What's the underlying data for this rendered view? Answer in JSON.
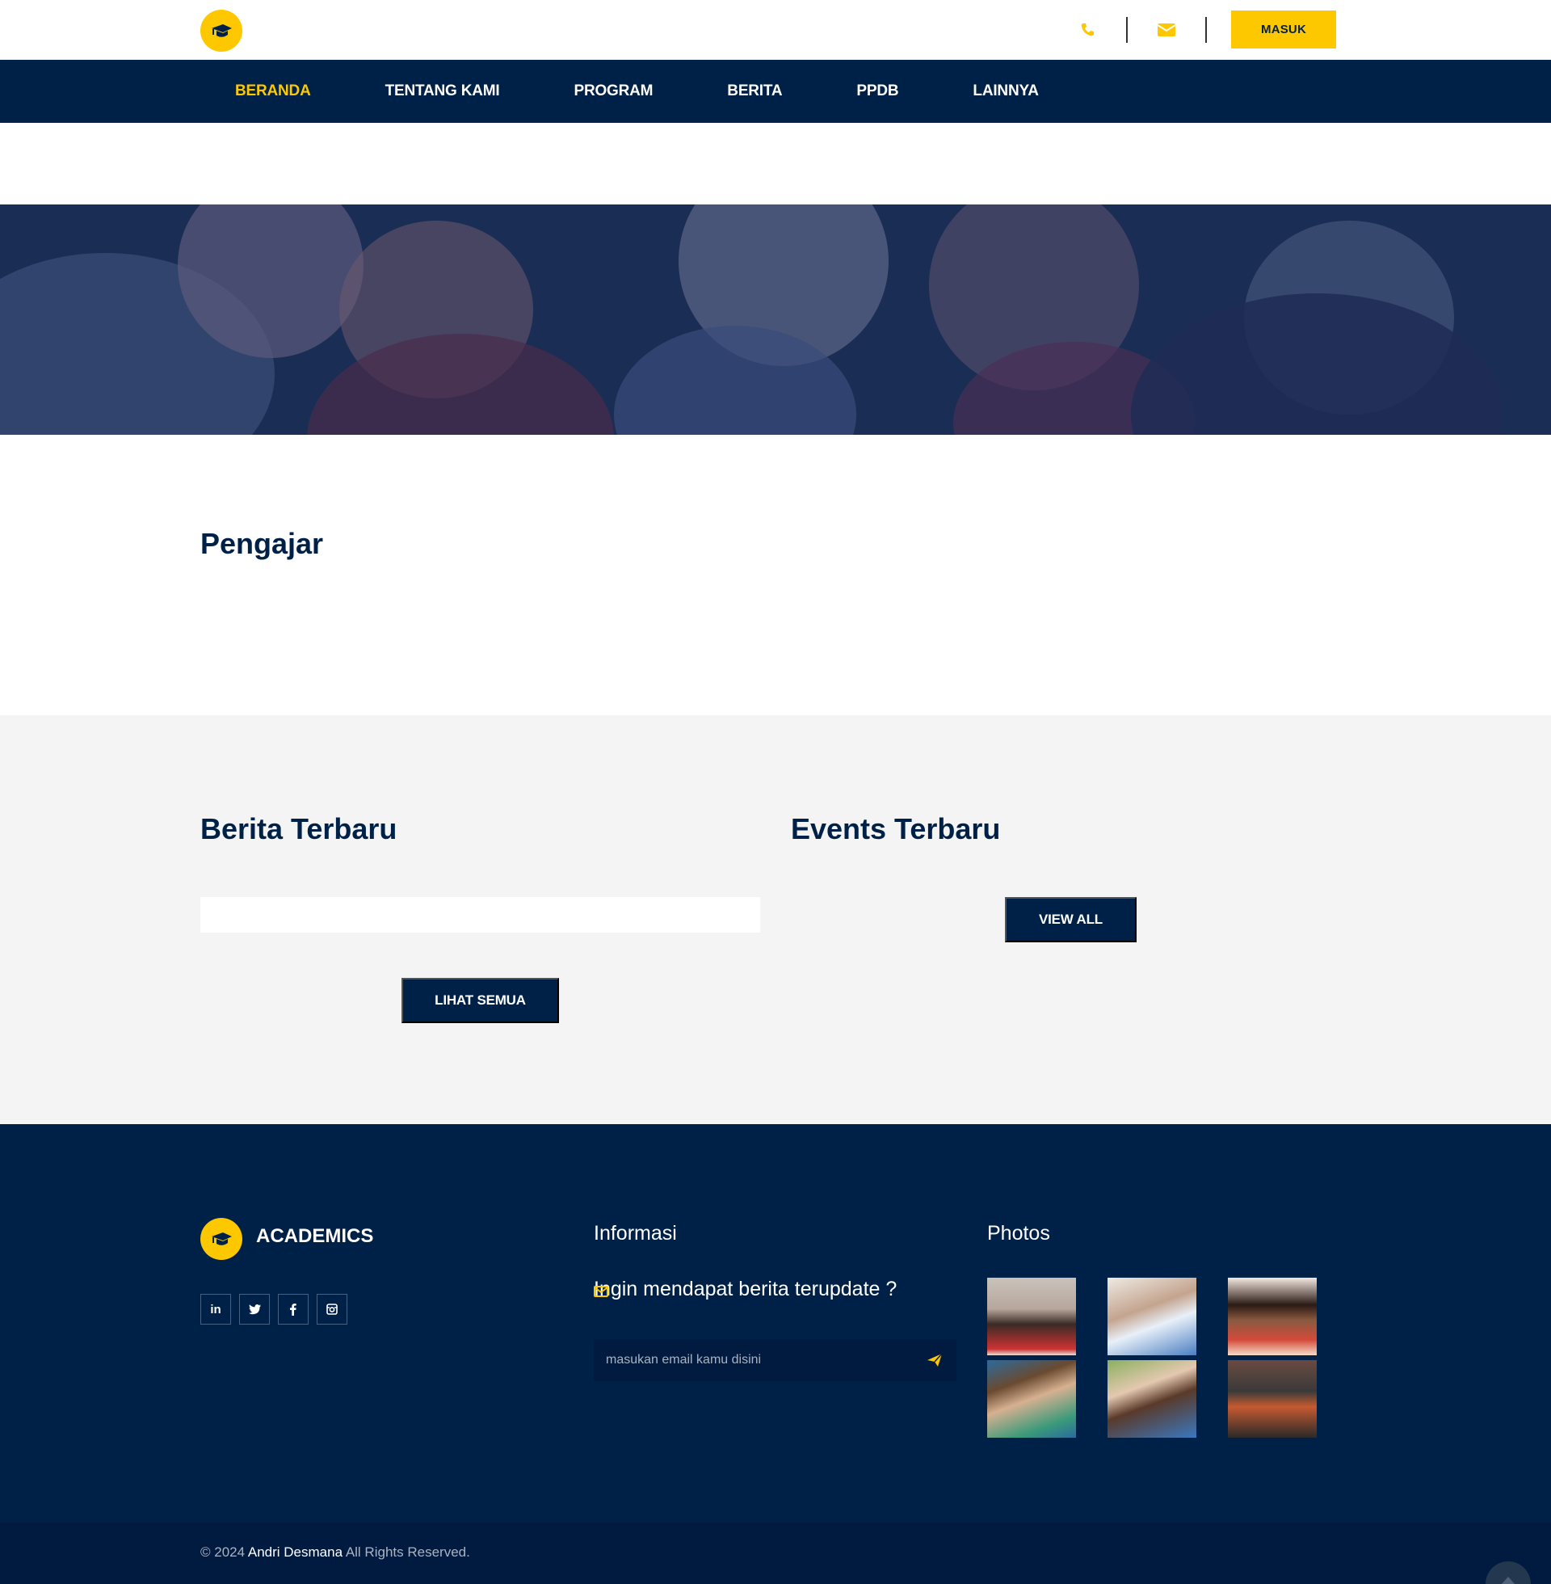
{
  "header": {
    "login_label": "MASUK",
    "icons": [
      "graduation-cap-icon",
      "phone-icon",
      "mail-icon"
    ]
  },
  "nav": {
    "items": [
      {
        "label": "BERANDA",
        "active": true
      },
      {
        "label": "TENTANG KAMI",
        "active": false
      },
      {
        "label": "PROGRAM",
        "active": false
      },
      {
        "label": "BERITA",
        "active": false
      },
      {
        "label": "PPDB",
        "active": false
      },
      {
        "label": "LAINNYA",
        "active": false
      }
    ]
  },
  "sections": {
    "pengajar_title": "Pengajar",
    "berita_title": "Berita Terbaru",
    "events_title": "Events Terbaru",
    "lihat_semua_label": "LIHAT SEMUA",
    "view_all_label": "VIEW ALL"
  },
  "footer": {
    "brand": "ACADEMICS",
    "socials": [
      "in",
      "t",
      "f",
      "ig"
    ],
    "info_heading": "Informasi",
    "question": "Ingin mendapat berita terupdate ?",
    "email_placeholder": "masukan email kamu disini",
    "photos_heading": "Photos",
    "photo_count": 6
  },
  "bottom": {
    "copy_prefix": "© 2024 ",
    "copy_name": "Andri Desmana",
    "copy_suffix": " All Rights Reserved."
  },
  "colors": {
    "primary": "#002147",
    "accent": "#fdc800",
    "grey_bg": "#f4f4f4"
  }
}
